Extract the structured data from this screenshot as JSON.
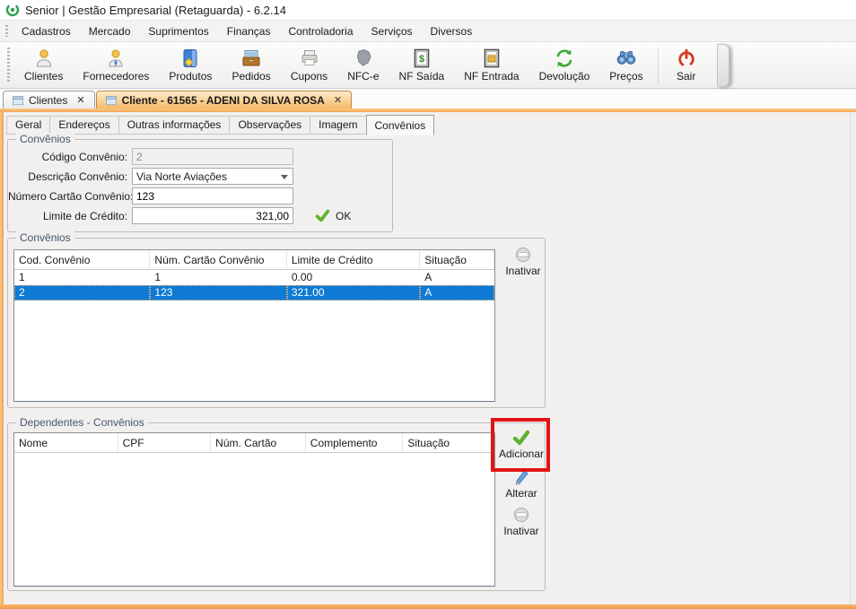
{
  "window": {
    "title": "Senior | Gestão Empresarial (Retaguarda) - 6.2.14",
    "app_logo_icon": "senior-logo-icon"
  },
  "menu": {
    "items": [
      "Cadastros",
      "Mercado",
      "Suprimentos",
      "Finanças",
      "Controladoria",
      "Serviços",
      "Diversos"
    ]
  },
  "toolbar": {
    "buttons": [
      {
        "label": "Clientes",
        "icon": "clientes"
      },
      {
        "label": "Fornecedores",
        "icon": "fornecedores"
      },
      {
        "label": "Produtos",
        "icon": "produtos"
      },
      {
        "label": "Pedidos",
        "icon": "pedidos"
      },
      {
        "label": "Cupons",
        "icon": "cupons"
      },
      {
        "label": "NFC-e",
        "icon": "nfce"
      },
      {
        "label": "NF Saída",
        "icon": "nf-saida"
      },
      {
        "label": "NF Entrada",
        "icon": "nf-entrada"
      },
      {
        "label": "Devolução",
        "icon": "devolucao"
      },
      {
        "label": "Preços",
        "icon": "precos"
      },
      {
        "label": "Sair",
        "icon": "sair",
        "separator_before": true
      }
    ]
  },
  "doc_tabs": [
    {
      "label": "Clientes",
      "active": false,
      "close_glyph": "✕"
    },
    {
      "label": "Cliente - 61565 - ADENI DA SILVA ROSA",
      "active": true,
      "close_glyph": "✕"
    }
  ],
  "subtabs": {
    "active": "Convênios",
    "items": [
      "Geral",
      "Endereços",
      "Outras informações",
      "Observações",
      "Imagem",
      "Convênios"
    ]
  },
  "form": {
    "group_title": "Convênios",
    "fields": [
      {
        "label": "Código Convênio:",
        "value": "2",
        "state": "disabled"
      },
      {
        "label": "Descrição Convênio:",
        "value": "Via Norte Aviações",
        "type": "combo"
      },
      {
        "label": "Número Cartão Convênio:",
        "value": "123"
      },
      {
        "label": "Limite de Crédito:",
        "value": "321,00",
        "align": "right"
      }
    ],
    "ok_label": "OK"
  },
  "convenios": {
    "group_title": "Convênios",
    "columns": [
      "Cod. Convênio",
      "Núm. Cartão Convênio",
      "Limite de Crédito",
      "Situação"
    ],
    "rows": [
      [
        "1",
        "1",
        "0.00",
        "A"
      ],
      [
        "2",
        "123",
        "321.00",
        "A"
      ]
    ],
    "selected_row_index": 1,
    "inativar_label": "Inativar"
  },
  "dependentes": {
    "group_title": "Dependentes - Convênios",
    "columns": [
      "Nome",
      "CPF",
      "Núm. Cartão",
      "Complemento",
      "Situação"
    ],
    "rows": [],
    "adicionar_label": "Adicionar",
    "alterar_label": "Alterar",
    "inativar_label": "Inativar"
  },
  "colors": {
    "accent_orange": "#f6b366",
    "active_tab_orange": "#f7ba67",
    "selection_blue": "#0f7ad4",
    "annotation_red": "#e21313",
    "check_green": "#5fb22d",
    "pencil_blue": "#4a86c8"
  }
}
